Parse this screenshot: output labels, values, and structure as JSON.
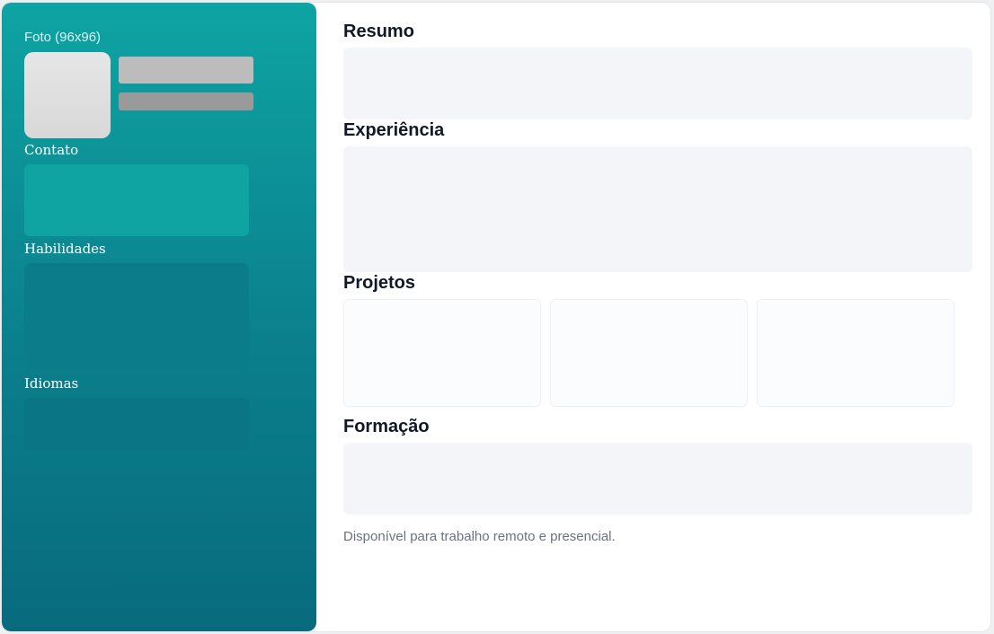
{
  "sidebar": {
    "photo_label": "Foto (96x96)",
    "sections": {
      "contact": "Contato",
      "skills": "Habilidades",
      "languages": "Idiomas"
    },
    "colors": {
      "gradient_top": "#0ea4a3",
      "gradient_bottom": "#086b7d"
    }
  },
  "main": {
    "sections": {
      "summary": "Resumo",
      "experience": "Experiência",
      "projects": "Projetos",
      "education": "Formação"
    },
    "footer_note": "Disponível para trabalho remoto e presencial."
  }
}
